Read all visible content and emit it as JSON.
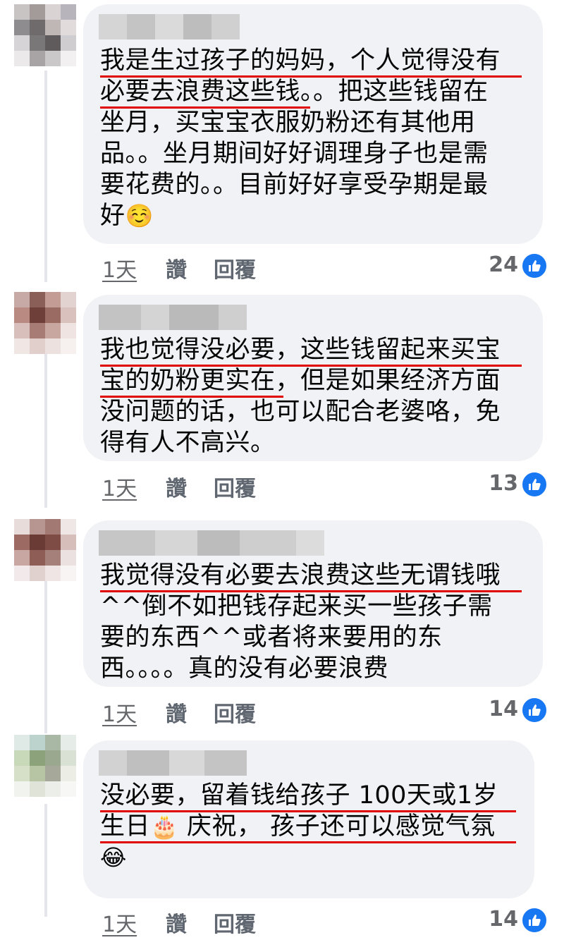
{
  "comments": [
    {
      "text_lines": [
        "我是生过孩子的妈妈，个人觉得没有",
        "必要去浪费这些钱。。把这些钱留在",
        "坐月，买宝宝衣服奶粉还有其他用",
        "品。。坐月期间好好调理身子也是需",
        "要花费的。。目前好好享受孕期是最",
        "好"
      ],
      "emoji": "☺️",
      "time": "1天",
      "like_label": "讚",
      "reply_label": "回覆",
      "like_count": "24"
    },
    {
      "text_lines": [
        "我也觉得没必要，这些钱留起来买宝",
        "宝的奶粉更实在，但是如果经济方面",
        "没问题的话，也可以配合老婆咯，免",
        "得有人不高兴。"
      ],
      "time": "1天",
      "like_label": "讚",
      "reply_label": "回覆",
      "like_count": "13"
    },
    {
      "text_lines": [
        "我觉得没有必要去浪费这些无谓钱哦",
        "^^倒不如把钱存起来买一些孩子需",
        "要的东西^^或者将来要用的东",
        "西。。。。真的没有必要浪费"
      ],
      "time": "1天",
      "like_label": "讚",
      "reply_label": "回覆",
      "like_count": "14"
    },
    {
      "text_lines": [
        "没必要，留着钱给孩子 100天或1岁",
        "生日",
        " 庆祝， 孩子还可以感觉气氛"
      ],
      "cake": "🎂",
      "laugh": "😂",
      "time": "1天",
      "like_label": "讚",
      "reply_label": "回覆",
      "like_count": "14"
    }
  ],
  "colors": {
    "bubble": "#f0f2f5",
    "underline": "#e00000",
    "like_blue": "#1877f2",
    "meta": "#65676b"
  }
}
